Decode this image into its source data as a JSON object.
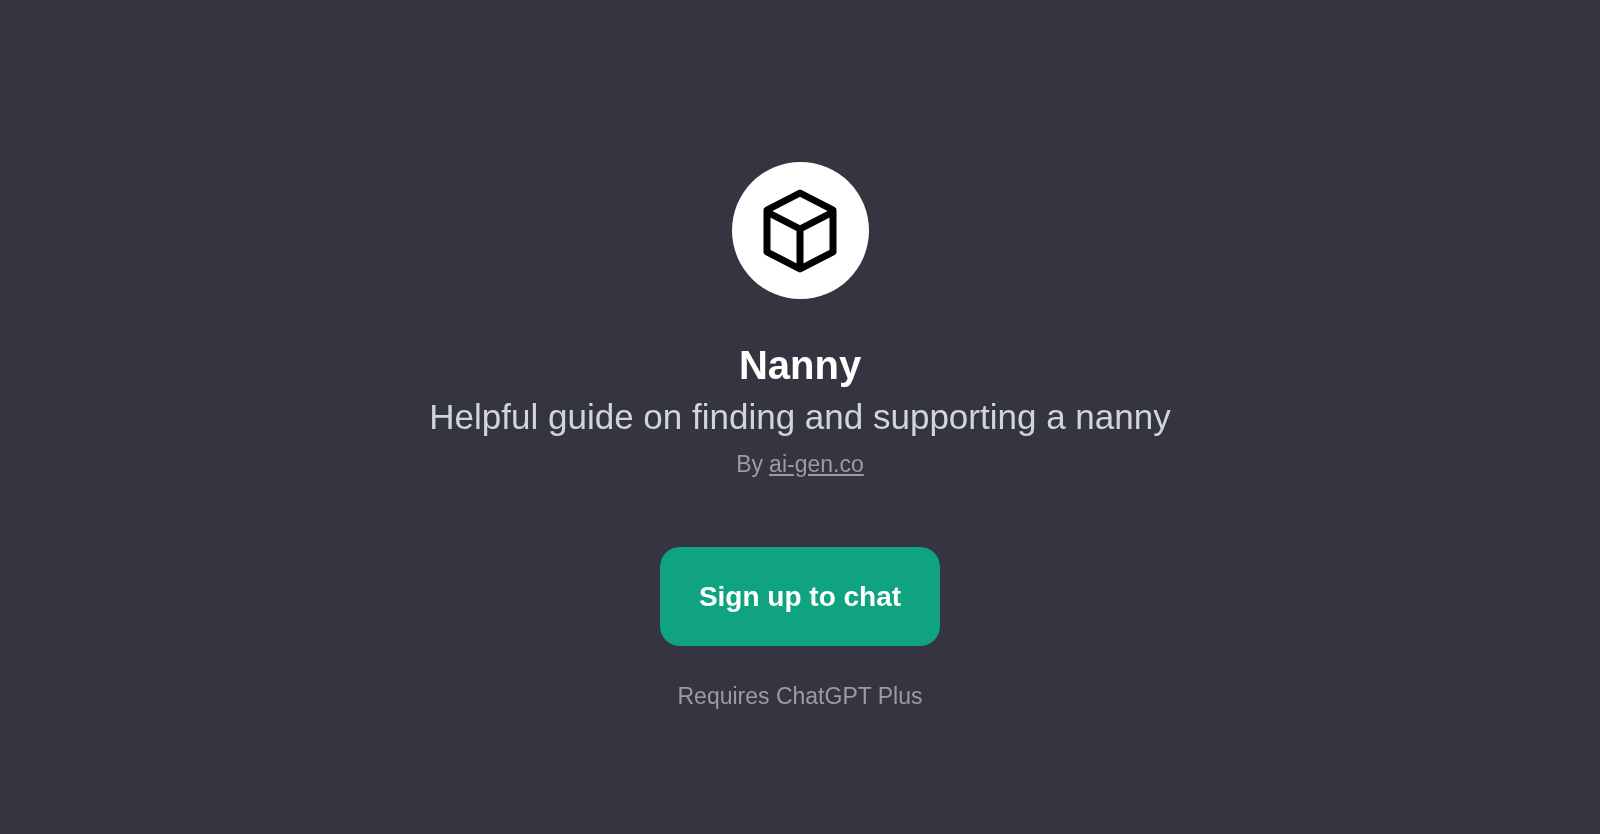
{
  "title": "Nanny",
  "description": "Helpful guide on finding and supporting a nanny",
  "author": {
    "prefix": "By",
    "link": "ai-gen.co"
  },
  "button": {
    "label": "Sign up to chat"
  },
  "note": "Requires ChatGPT Plus"
}
